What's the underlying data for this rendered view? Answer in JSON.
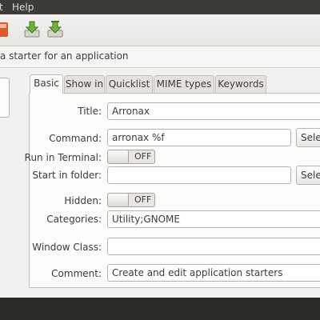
{
  "menubar": {
    "items": [
      "t",
      "Help"
    ]
  },
  "toolbar": {
    "buttons": [
      {
        "name": "document-icon",
        "color": "#e2582a"
      },
      {
        "name": "import-icon",
        "color": "#5a9a2f"
      },
      {
        "name": "export-icon",
        "color": "#5a9a2f"
      }
    ]
  },
  "banner": {
    "text": "a starter for an application"
  },
  "tabs": [
    "Basic",
    "Show in",
    "Quicklist",
    "MIME types",
    "Keywords"
  ],
  "form": {
    "title_label": "Title:",
    "title_value": "Arronax",
    "command_label": "Command:",
    "command_value": "arronax %f",
    "select_label": "Selec",
    "run_in_terminal_label": "Run in Terminal:",
    "run_in_terminal_state": "OFF",
    "start_in_folder_label": "Start in folder:",
    "start_in_folder_value": "",
    "hidden_label": "Hidden:",
    "hidden_state": "OFF",
    "categories_label": "Categories:",
    "categories_value": "Utility;GNOME",
    "window_class_label": "Window Class:",
    "window_class_value": "",
    "comment_label": "Comment:",
    "comment_value": "Create and edit application starters"
  }
}
